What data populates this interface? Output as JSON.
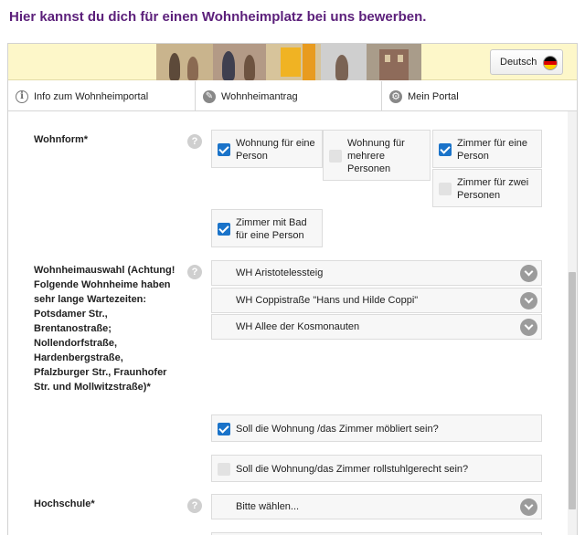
{
  "page": {
    "heading": "Hier kannst du dich für einen Wohnheimplatz bei uns bewerben."
  },
  "header": {
    "language_button": "Deutsch",
    "flag_colors": [
      "#000000",
      "#dd0000",
      "#ffce00"
    ]
  },
  "tabs": [
    {
      "label": "Info zum Wohnheimportal",
      "icon": "info-icon"
    },
    {
      "label": "Wohnheimantrag",
      "icon": "pencil-icon"
    },
    {
      "label": "Mein Portal",
      "icon": "gear-icon"
    }
  ],
  "form": {
    "wohnform": {
      "label": "Wohnform*",
      "options": [
        {
          "label": "Wohnung für eine Person",
          "checked": true
        },
        {
          "label": "Wohnung für mehrere Personen",
          "checked": false
        },
        {
          "label": "Zimmer für eine Person",
          "checked": true
        },
        {
          "label": "Zimmer für zwei Personen",
          "checked": false
        },
        {
          "label": "Zimmer mit Bad für eine Person",
          "checked": true
        }
      ]
    },
    "wohnheimauswahl": {
      "label": "Wohnheimauswahl (Achtung! Folgende Wohnheime haben sehr lange Wartezeiten: Potsdamer Str., Brentanostraße; Nollendorfstraße, Hardenbergstraße, Pfalzburger Str., Fraunhofer Str. und Mollwitzstraße)*",
      "selects": [
        "WH Aristotelessteig",
        "WH Coppistraße \"Hans und Hilde Coppi\"",
        "WH Allee der Kosmonauten"
      ]
    },
    "moebliert": {
      "label": "Soll die Wohnung /das Zimmer möbliert sein?",
      "checked": true
    },
    "rollstuhl": {
      "label": "Soll die Wohnung/das Zimmer rollstuhlgerecht sein?",
      "checked": false
    },
    "hochschule": {
      "label": "Hochschule*",
      "value": "Bitte wählen..."
    }
  },
  "colors": {
    "accent": "#1a73c9",
    "heading": "#5b1f7a",
    "banner": "#fdf7c9"
  }
}
